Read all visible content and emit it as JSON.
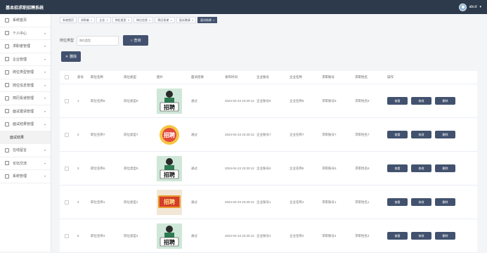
{
  "header": {
    "title": "基本招求职招聘系统",
    "user": "abcd"
  },
  "sidebar": {
    "items": [
      {
        "label": "系统首页",
        "icon": "home-icon"
      },
      {
        "label": "个人中心",
        "icon": "user-icon"
      },
      {
        "label": "求职者管理",
        "icon": "person-icon"
      },
      {
        "label": "企业管理",
        "icon": "building-icon"
      },
      {
        "label": "岗位类型管理",
        "icon": "grid-icon"
      },
      {
        "label": "岗位信息管理",
        "icon": "grid-icon"
      },
      {
        "label": "简历投递管理",
        "icon": "grid-icon"
      },
      {
        "label": "面试邀请管理",
        "icon": "grid-icon"
      },
      {
        "label": "面试结果管理",
        "icon": "grid-icon"
      },
      {
        "label": "面试结果",
        "icon": ""
      },
      {
        "label": "在线留言",
        "icon": "message-icon"
      },
      {
        "label": "论坛交流",
        "icon": "forum-icon"
      },
      {
        "label": "系统管理",
        "icon": "settings-icon"
      }
    ]
  },
  "tabs": [
    "系统首页",
    "求职者",
    "企业",
    "岗位类型",
    "岗位信息",
    "简历投递",
    "面试邀请",
    "面试结果"
  ],
  "search": {
    "label": "岗位类型",
    "placeholder": "岗位类型",
    "button": "查询"
  },
  "delete_button": "删除",
  "table": {
    "headers": [
      "索号",
      "职位名称",
      "岗位类型",
      "图片",
      "面试结果",
      "发布时间",
      "企业账号",
      "企业名称",
      "求职账号",
      "求职姓名",
      "操作"
    ],
    "rows": [
      {
        "no": "1",
        "job": "职位名称8",
        "type": "岗位类型8",
        "result": "通过",
        "date": "2024-04-23 23:30:12",
        "corp_acct": "企业账号8",
        "corp_name": "企业名称8",
        "seeker_acct": "求职账号8",
        "seeker_name": "求职姓名8",
        "img": "green"
      },
      {
        "no": "2",
        "job": "职位名称7",
        "type": "岗位类型7",
        "result": "通过",
        "date": "2024-04-23 23:30:12",
        "corp_acct": "企业账号7",
        "corp_name": "企业名称7",
        "seeker_acct": "求职账号7",
        "seeker_name": "求职姓名7",
        "img": "white"
      },
      {
        "no": "3",
        "job": "职位名称6",
        "type": "岗位类型6",
        "result": "通过",
        "date": "2024-04-23 23:30:12",
        "corp_acct": "企业账号6",
        "corp_name": "企业名称6",
        "seeker_acct": "求职账号6",
        "seeker_name": "求职姓名6",
        "img": "green"
      },
      {
        "no": "4",
        "job": "职位名称1",
        "type": "岗位类型1",
        "result": "通过",
        "date": "2024-04-23 23:30:12",
        "corp_acct": "企业账号1",
        "corp_name": "企业名称1",
        "seeker_acct": "求职账号1",
        "seeker_name": "求职姓名1",
        "img": "orange"
      },
      {
        "no": "5",
        "job": "职位名称4",
        "type": "岗位类型4",
        "result": "通过",
        "date": "2024-04-23 23:30:12",
        "corp_acct": "企业账号4",
        "corp_name": "企业名称4",
        "seeker_acct": "求职账号4",
        "seeker_name": "求职姓名4",
        "img": "green"
      }
    ],
    "actions": [
      "查看",
      "修改",
      "删除"
    ],
    "image_text": "招聘"
  }
}
